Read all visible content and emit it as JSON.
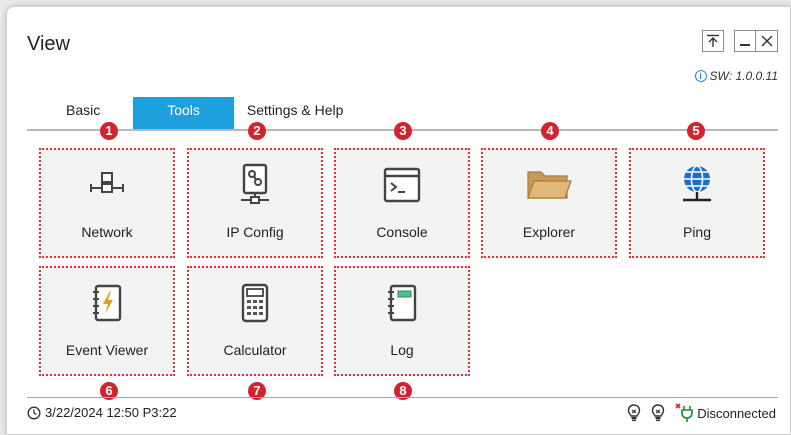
{
  "window": {
    "title": "View"
  },
  "version": {
    "text": "SW: 1.0.0.11"
  },
  "tabs": [
    {
      "label": "Basic"
    },
    {
      "label": "Tools"
    },
    {
      "label": "Settings & Help"
    }
  ],
  "active_tab": "Tools",
  "tools": [
    {
      "label": "Network",
      "badge": "1",
      "icon": "network-icon"
    },
    {
      "label": "IP Config",
      "badge": "2",
      "icon": "ip-config-icon"
    },
    {
      "label": "Console",
      "badge": "3",
      "icon": "console-icon"
    },
    {
      "label": "Explorer",
      "badge": "4",
      "icon": "folder-icon"
    },
    {
      "label": "Ping",
      "badge": "5",
      "icon": "globe-icon"
    },
    {
      "label": "Event Viewer",
      "badge": "6",
      "icon": "event-viewer-icon"
    },
    {
      "label": "Calculator",
      "badge": "7",
      "icon": "calculator-icon"
    },
    {
      "label": "Log",
      "badge": "8",
      "icon": "notebook-icon"
    }
  ],
  "status": {
    "datetime": "3/22/2024 12:50 P3:22",
    "connection": "Disconnected"
  },
  "colors": {
    "accent": "#1ea0dc",
    "badge": "#d0252e",
    "folder": "#d8a866",
    "globe": "#1b6fc8"
  }
}
